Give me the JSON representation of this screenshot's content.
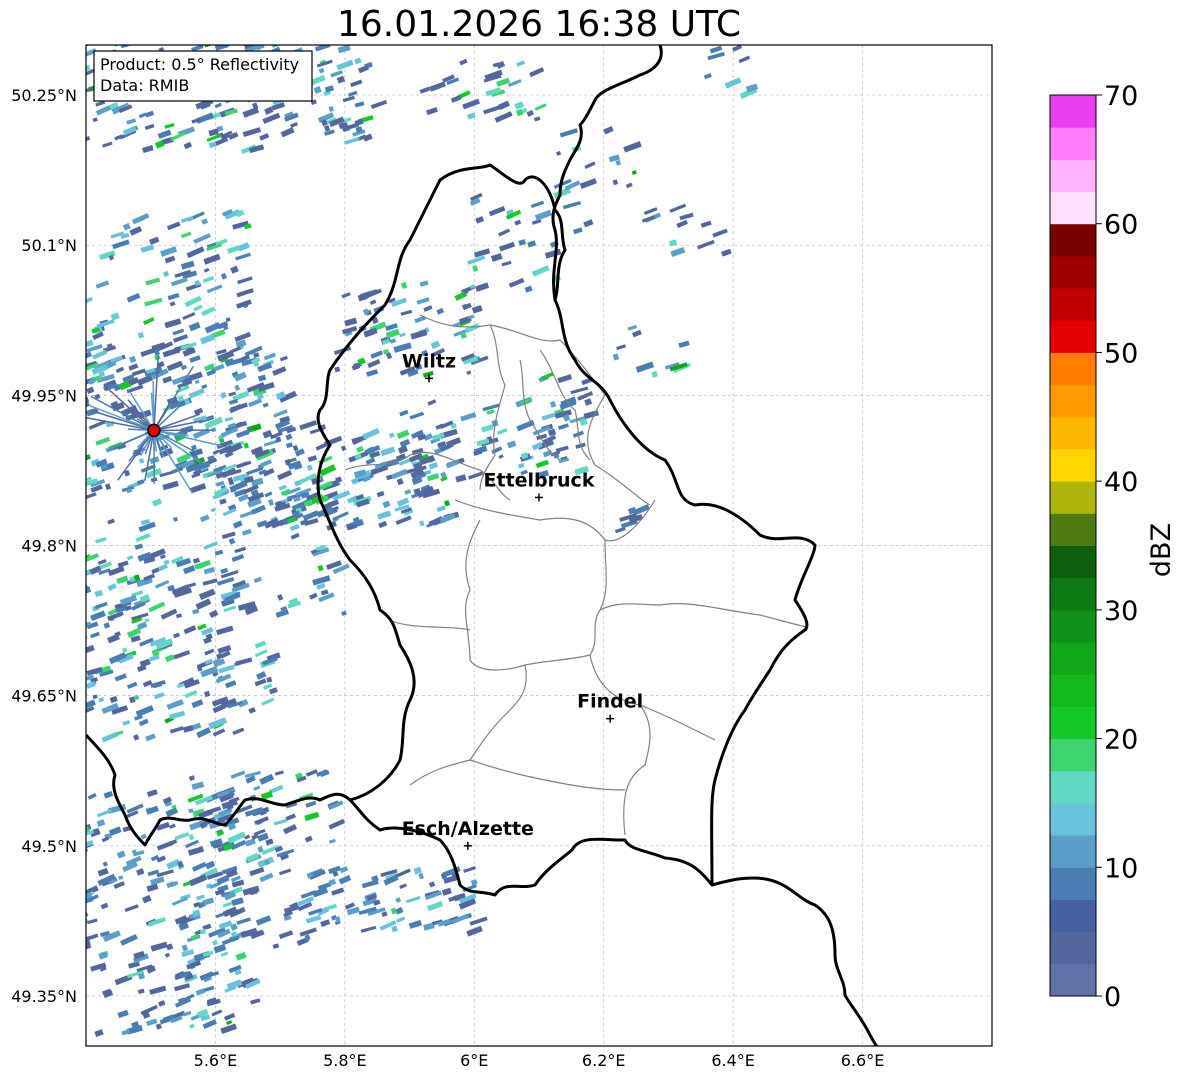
{
  "title": "16.01.2026 16:38 UTC",
  "info_box": {
    "product": "Product: 0.5° Reflectivity",
    "data": "Data: RMIB"
  },
  "x_ticks": [
    "5.6°E",
    "5.8°E",
    "6°E",
    "6.2°E",
    "6.4°E",
    "6.6°E"
  ],
  "y_ticks": [
    "50.25°N",
    "50.1°N",
    "49.95°N",
    "49.8°N",
    "49.65°N",
    "49.5°N",
    "49.35°N"
  ],
  "cities": [
    {
      "name": "Wiltz",
      "lon": 5.93,
      "lat": 49.967
    },
    {
      "name": "Ettelbruck",
      "lon": 6.1,
      "lat": 49.848
    },
    {
      "name": "Findel",
      "lon": 6.21,
      "lat": 49.627
    },
    {
      "name": "Esch/Alzette",
      "lon": 5.99,
      "lat": 49.5
    }
  ],
  "radar_site": {
    "lon": 5.505,
    "lat": 49.915
  },
  "colorbar": {
    "label": "dBZ",
    "ticks": [
      "0",
      "10",
      "20",
      "30",
      "40",
      "50",
      "60",
      "70"
    ],
    "range": [
      0,
      70
    ],
    "colors": [
      "#6272a8",
      "#53679e",
      "#4660a3",
      "#4a7db4",
      "#5a9ec9",
      "#68c2dc",
      "#62d7c4",
      "#3dd36f",
      "#14c82a",
      "#13b81d",
      "#12a61a",
      "#10921a",
      "#0d7b14",
      "#0b5f0d",
      "#4d7a12",
      "#adb40b",
      "#ffd700",
      "#ffb800",
      "#ff9a00",
      "#ff7e00",
      "#e50000",
      "#c00000",
      "#a00000",
      "#7a0000",
      "#ffe2ff",
      "#ffb4ff",
      "#ff7dff",
      "#ea3ef0"
    ]
  },
  "map_extent": {
    "lon": [
      5.4,
      6.8
    ],
    "lat": [
      49.3,
      50.3
    ]
  },
  "echo_colors": [
    "#53679e",
    "#4a7db4",
    "#5a9ec9",
    "#68c2dc",
    "#62d7c4",
    "#3dd36f",
    "#14c82a",
    "#12a61a"
  ]
}
